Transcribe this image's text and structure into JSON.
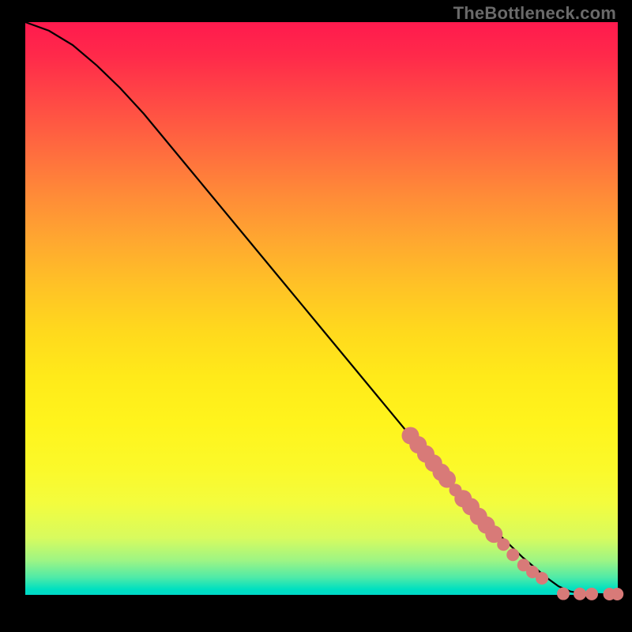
{
  "watermark": "TheBottleneck.com",
  "colors": {
    "dot_fill": "#d87a78",
    "curve_stroke": "#000000",
    "frame_bg": "#000000",
    "gradient_top": "#ff1a4e",
    "gradient_bottom": "#00d8c8"
  },
  "chart_data": {
    "type": "line",
    "title": "",
    "xlabel": "",
    "ylabel": "",
    "xlim": [
      0,
      100
    ],
    "ylim": [
      0,
      100
    ],
    "series": [
      {
        "name": "curve",
        "x": [
          0,
          4,
          8,
          12,
          16,
          20,
          24,
          28,
          32,
          36,
          40,
          44,
          48,
          52,
          56,
          60,
          64,
          68,
          72,
          76,
          80,
          84,
          88,
          90,
          92,
          94,
          96,
          98,
          100
        ],
        "y": [
          100,
          98.5,
          96,
          92.5,
          88.5,
          84,
          79,
          74,
          69,
          64,
          59,
          54,
          49,
          44,
          39,
          34,
          29,
          24,
          19.5,
          15,
          10.5,
          6.5,
          3,
          1.5,
          0.6,
          0.25,
          0.15,
          0.12,
          0.12
        ]
      }
    ],
    "scatter": [
      {
        "name": "dots",
        "points": [
          {
            "x": 65.0,
            "y": 27.8,
            "r": 1.4
          },
          {
            "x": 66.3,
            "y": 26.2,
            "r": 1.4
          },
          {
            "x": 67.6,
            "y": 24.6,
            "r": 1.4
          },
          {
            "x": 68.9,
            "y": 23.0,
            "r": 1.4
          },
          {
            "x": 70.2,
            "y": 21.4,
            "r": 1.4
          },
          {
            "x": 71.2,
            "y": 20.2,
            "r": 1.4
          },
          {
            "x": 72.6,
            "y": 18.3,
            "r": 1.1
          },
          {
            "x": 73.9,
            "y": 16.8,
            "r": 1.4
          },
          {
            "x": 75.2,
            "y": 15.4,
            "r": 1.4
          },
          {
            "x": 76.5,
            "y": 13.7,
            "r": 1.4
          },
          {
            "x": 77.8,
            "y": 12.2,
            "r": 1.4
          },
          {
            "x": 79.1,
            "y": 10.6,
            "r": 1.4
          },
          {
            "x": 80.7,
            "y": 8.8,
            "r": 1.1
          },
          {
            "x": 82.3,
            "y": 7.0,
            "r": 1.1
          },
          {
            "x": 84.1,
            "y": 5.2,
            "r": 1.1
          },
          {
            "x": 85.6,
            "y": 4.0,
            "r": 1.1
          },
          {
            "x": 87.2,
            "y": 2.9,
            "r": 1.1
          },
          {
            "x": 90.8,
            "y": 0.2,
            "r": 1.1
          },
          {
            "x": 93.6,
            "y": 0.18,
            "r": 1.1
          },
          {
            "x": 95.6,
            "y": 0.16,
            "r": 1.1
          },
          {
            "x": 98.6,
            "y": 0.14,
            "r": 1.1
          },
          {
            "x": 99.9,
            "y": 0.14,
            "r": 1.1
          }
        ]
      }
    ]
  }
}
